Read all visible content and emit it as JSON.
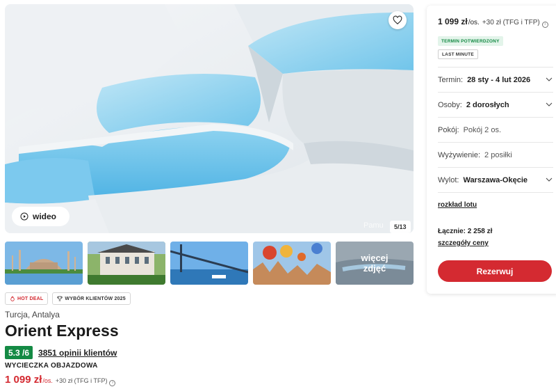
{
  "gallery": {
    "video_label": "wideo",
    "watermark": "Pamu",
    "counter": "5/13",
    "more_photos_label": "więcej zdjęć"
  },
  "badges": {
    "hot_deal": "HOT DEAL",
    "customer_choice": "WYBÓR KLIENTÓW 2025"
  },
  "offer": {
    "location": "Turcja, Antalya",
    "title": "Orient Express",
    "rating": "5.3 /6",
    "reviews": "3851 opinii klientów",
    "trip_type": "WYCIECZKA OBJAZDOWA",
    "price": "1 099 zł",
    "per_person": "/os.",
    "extra_fee": "+30 zł (TFG i TFP)"
  },
  "booking": {
    "price": "1 099 zł",
    "per_person": "/os.",
    "extra_fee": "+30 zł (TFG i TFP)",
    "tag_confirmed": "TERMIN POTWIERDZONY",
    "tag_last_minute": "LAST MINUTE",
    "term_label": "Termin:",
    "term_value": "28 sty - 4 lut 2026",
    "persons_label": "Osoby:",
    "persons_value": "2 dorosłych",
    "room_label": "Pokój:",
    "room_value": "Pokój 2 os.",
    "board_label": "Wyżywienie:",
    "board_value": "2 posiłki",
    "departure_label": "Wylot:",
    "departure_value": "Warszawa-Okęcie",
    "flight_schedule_link": "rozkład lotu",
    "total": "Łącznie: 2 258 zł",
    "price_details_link": "szczegóły ceny",
    "book_button": "Rezerwuj"
  },
  "colors": {
    "brand_red": "#d42a31",
    "rating_green": "#148a44"
  }
}
